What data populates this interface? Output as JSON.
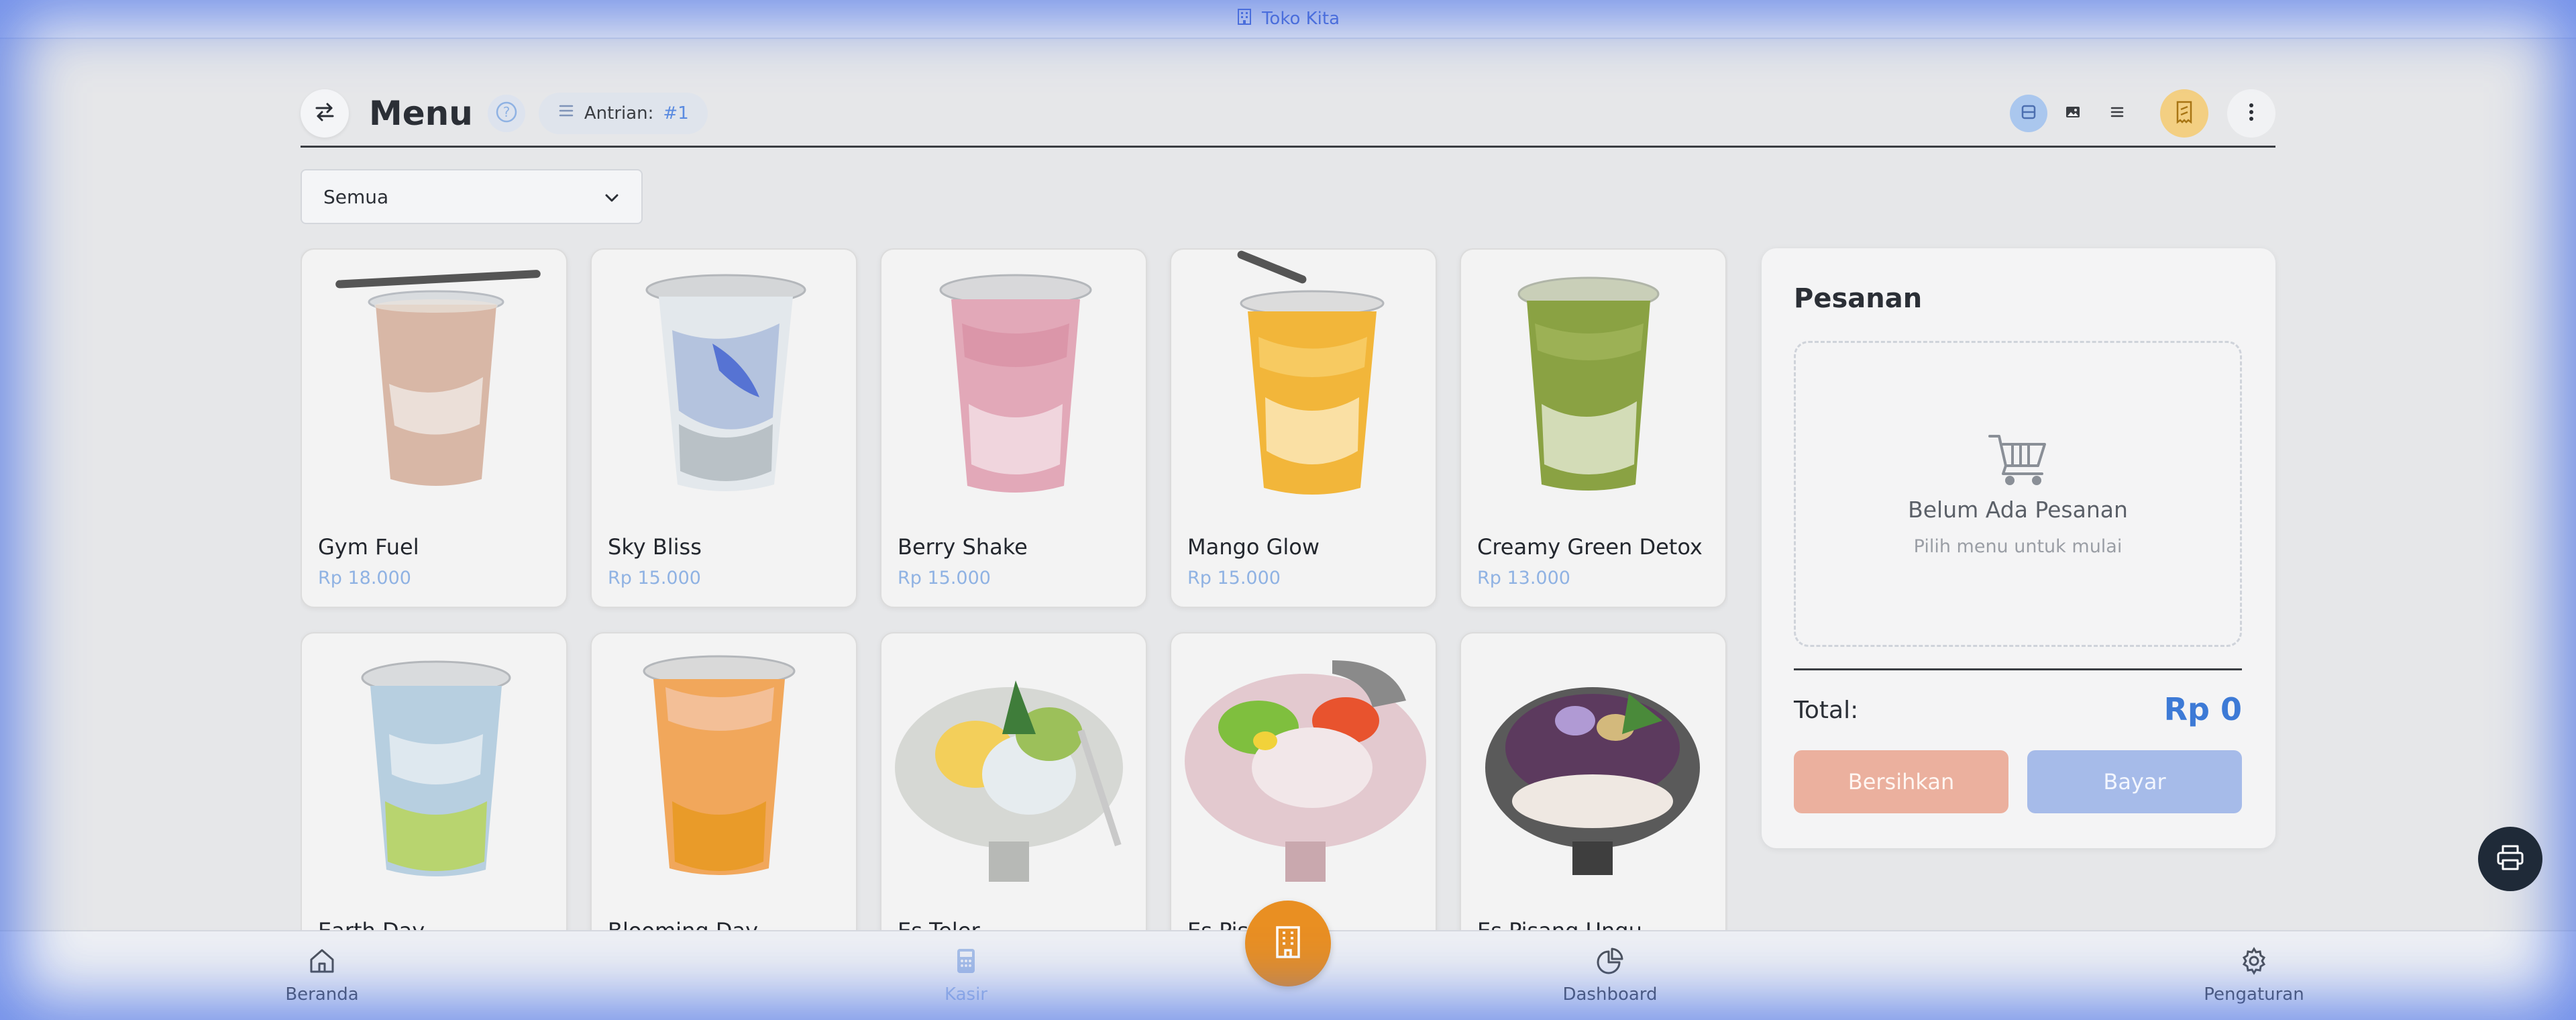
{
  "app": {
    "store_name": "Toko Kita"
  },
  "header": {
    "title": "Menu",
    "queue_label": "Antrian:",
    "queue_number": "#1"
  },
  "filter": {
    "selected": "Semua"
  },
  "menu_items": [
    {
      "name": "Gym Fuel",
      "price": "Rp 18.000"
    },
    {
      "name": "Sky Bliss",
      "price": "Rp 15.000"
    },
    {
      "name": "Berry Shake",
      "price": "Rp 15.000"
    },
    {
      "name": "Mango Glow",
      "price": "Rp 15.000"
    },
    {
      "name": "Creamy Green Detox",
      "price": "Rp 13.000"
    },
    {
      "name": "Earth Day",
      "price": ""
    },
    {
      "name": "Blooming Day",
      "price": ""
    },
    {
      "name": "Es Teler",
      "price": ""
    },
    {
      "name": "Es Pis",
      "price": ""
    },
    {
      "name": "Es Pisang Ungu",
      "price": ""
    }
  ],
  "order": {
    "title": "Pesanan",
    "empty_title": "Belum Ada Pesanan",
    "empty_subtitle": "Pilih menu untuk mulai",
    "total_label": "Total:",
    "total_value": "Rp 0",
    "clear_label": "Bersihkan",
    "pay_label": "Bayar"
  },
  "nav": {
    "home": "Beranda",
    "cashier": "Kasir",
    "dashboard": "Dashboard",
    "settings": "Pengaturan"
  },
  "colors": {
    "accent_blue": "#3d7ad6",
    "fab_orange": "#e98f22",
    "clear_button": "#ebb09e",
    "pay_button": "#a6bbe9",
    "price_text": "#8fb2e3"
  }
}
